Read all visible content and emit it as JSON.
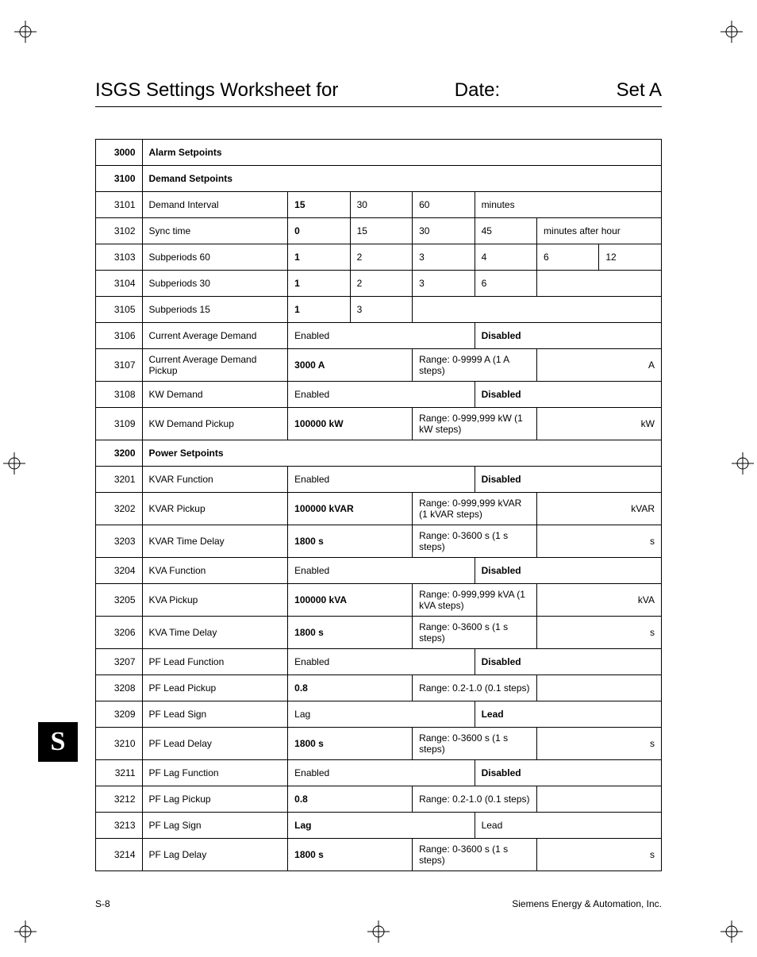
{
  "header": {
    "title": "ISGS Settings Worksheet for",
    "date_label": "Date:",
    "set_label": "Set A"
  },
  "sidetab": "S",
  "footer": {
    "page": "S-8",
    "company": "Siemens Energy & Automation, Inc."
  },
  "sections": [
    {
      "id": "3000",
      "name": "Alarm Setpoints",
      "rows": []
    },
    {
      "id": "3100",
      "name": "Demand Setpoints",
      "rows": [
        {
          "id": "3101",
          "name": "Demand Interval",
          "cells": [
            {
              "text": "15",
              "bold": true
            },
            {
              "text": "30"
            },
            {
              "text": "60"
            },
            {
              "text": "minutes",
              "span": 3
            }
          ]
        },
        {
          "id": "3102",
          "name": "Sync time",
          "cells": [
            {
              "text": "0",
              "bold": true
            },
            {
              "text": "15"
            },
            {
              "text": "30"
            },
            {
              "text": "45"
            },
            {
              "text": "minutes after hour",
              "span": 2
            }
          ]
        },
        {
          "id": "3103",
          "name": "Subperiods 60",
          "cells": [
            {
              "text": "1",
              "bold": true
            },
            {
              "text": "2"
            },
            {
              "text": "3"
            },
            {
              "text": "4"
            },
            {
              "text": "6"
            },
            {
              "text": "12"
            }
          ]
        },
        {
          "id": "3104",
          "name": "Subperiods 30",
          "cells": [
            {
              "text": "1",
              "bold": true
            },
            {
              "text": "2"
            },
            {
              "text": "3"
            },
            {
              "text": "6"
            },
            {
              "text": "",
              "span": 2
            }
          ]
        },
        {
          "id": "3105",
          "name": "Subperiods 15",
          "cells": [
            {
              "text": "1",
              "bold": true
            },
            {
              "text": "3"
            },
            {
              "text": "",
              "span": 4
            }
          ]
        },
        {
          "id": "3106",
          "name": "Current Average Demand",
          "cells": [
            {
              "text": "Enabled",
              "span": 3
            },
            {
              "text": "Disabled",
              "bold": true,
              "span": 3
            }
          ]
        },
        {
          "id": "3107",
          "name": "Current Average Demand Pickup",
          "cells": [
            {
              "text": "3000 A",
              "bold": true,
              "span": 2
            },
            {
              "text": "Range:  0-9999 A  (1 A steps)",
              "span": 2
            },
            {
              "text": "A",
              "span": 2,
              "right": true
            }
          ]
        },
        {
          "id": "3108",
          "name": "KW Demand",
          "cells": [
            {
              "text": "Enabled",
              "span": 3
            },
            {
              "text": "Disabled",
              "bold": true,
              "span": 3
            }
          ]
        },
        {
          "id": "3109",
          "name": "KW Demand Pickup",
          "cells": [
            {
              "text": "100000 kW",
              "bold": true,
              "span": 2
            },
            {
              "text": "Range:  0-999,999 kW (1 kW steps)",
              "span": 2
            },
            {
              "text": "kW",
              "span": 2,
              "right": true
            }
          ]
        }
      ]
    },
    {
      "id": "3200",
      "name": "Power  Setpoints",
      "rows": [
        {
          "id": "3201",
          "name": "KVAR Function",
          "cells": [
            {
              "text": "Enabled",
              "span": 3
            },
            {
              "text": "Disabled",
              "bold": true,
              "span": 3
            }
          ]
        },
        {
          "id": "3202",
          "name": "KVAR Pickup",
          "cells": [
            {
              "text": "100000 kVAR",
              "bold": true,
              "span": 2
            },
            {
              "text": "Range:  0-999,999 kVAR (1 kVAR steps)",
              "span": 2
            },
            {
              "text": "kVAR",
              "span": 2,
              "right": true
            }
          ]
        },
        {
          "id": "3203",
          "name": "KVAR Time Delay",
          "cells": [
            {
              "text": "1800 s",
              "bold": true,
              "span": 2
            },
            {
              "text": "Range:  0-3600 s  (1 s steps)",
              "span": 2
            },
            {
              "text": "s",
              "span": 2,
              "right": true
            }
          ]
        },
        {
          "id": "3204",
          "name": "KVA Function",
          "cells": [
            {
              "text": "Enabled",
              "span": 3
            },
            {
              "text": "Disabled",
              "bold": true,
              "span": 3
            }
          ]
        },
        {
          "id": "3205",
          "name": "KVA Pickup",
          "cells": [
            {
              "text": "100000 kVA",
              "bold": true,
              "span": 2
            },
            {
              "text": "Range:  0-999,999 kVA (1 kVA steps)",
              "span": 2
            },
            {
              "text": "kVA",
              "span": 2,
              "right": true
            }
          ]
        },
        {
          "id": "3206",
          "name": "KVA Time Delay",
          "cells": [
            {
              "text": "1800 s",
              "bold": true,
              "span": 2
            },
            {
              "text": "Range:  0-3600 s  (1 s steps)",
              "span": 2
            },
            {
              "text": "s",
              "span": 2,
              "right": true
            }
          ]
        },
        {
          "id": "3207",
          "name": "PF Lead Function",
          "cells": [
            {
              "text": "Enabled",
              "span": 3
            },
            {
              "text": "Disabled",
              "bold": true,
              "span": 3
            }
          ]
        },
        {
          "id": "3208",
          "name": "PF Lead Pickup",
          "cells": [
            {
              "text": "0.8",
              "bold": true,
              "span": 2
            },
            {
              "text": "Range:  0.2-1.0  (0.1 steps)",
              "span": 2
            },
            {
              "text": "",
              "span": 2
            }
          ]
        },
        {
          "id": "3209",
          "name": "PF Lead Sign",
          "cells": [
            {
              "text": "Lag",
              "span": 3
            },
            {
              "text": "Lead",
              "bold": true,
              "span": 3
            }
          ]
        },
        {
          "id": "3210",
          "name": "PF Lead Delay",
          "cells": [
            {
              "text": "1800 s",
              "bold": true,
              "span": 2
            },
            {
              "text": "Range:  0-3600 s  (1 s steps)",
              "span": 2
            },
            {
              "text": "s",
              "span": 2,
              "right": true
            }
          ]
        },
        {
          "id": "3211",
          "name": "PF Lag Function",
          "cells": [
            {
              "text": "Enabled",
              "span": 3
            },
            {
              "text": "Disabled",
              "bold": true,
              "span": 3
            }
          ]
        },
        {
          "id": "3212",
          "name": "PF Lag Pickup",
          "cells": [
            {
              "text": "0.8",
              "bold": true,
              "span": 2
            },
            {
              "text": "Range:  0.2-1.0  (0.1 steps)",
              "span": 2
            },
            {
              "text": "",
              "span": 2
            }
          ]
        },
        {
          "id": "3213",
          "name": "PF Lag Sign",
          "cells": [
            {
              "text": "Lag",
              "bold": true,
              "span": 3
            },
            {
              "text": "Lead",
              "span": 3
            }
          ]
        },
        {
          "id": "3214",
          "name": "PF Lag Delay",
          "cells": [
            {
              "text": "1800 s",
              "bold": true,
              "span": 2
            },
            {
              "text": "Range:  0-3600 s  (1 s steps)",
              "span": 2
            },
            {
              "text": "s",
              "span": 2,
              "right": true
            }
          ]
        }
      ]
    }
  ]
}
